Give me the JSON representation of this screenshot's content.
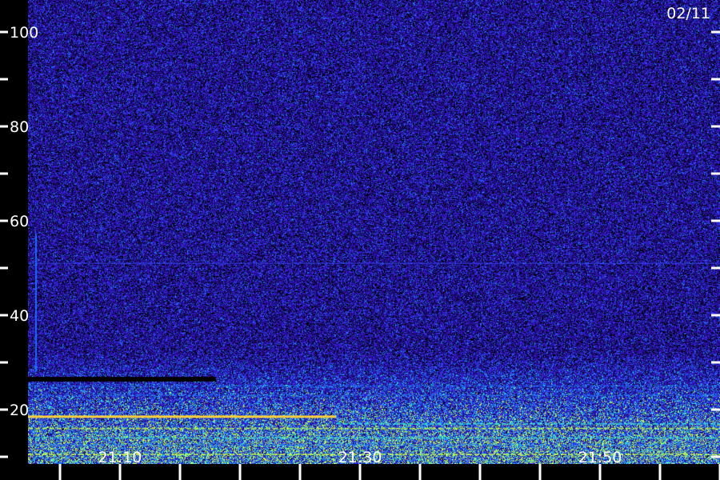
{
  "chart_data": {
    "type": "heatmap",
    "title": "",
    "date_label": "02/11",
    "xlabel": "",
    "ylabel": "",
    "x_ticks": [
      "21:10",
      "21:30",
      "21:50"
    ],
    "y_ticks": [
      20,
      40,
      60,
      80,
      100
    ],
    "ylim": [
      5,
      107
    ],
    "colormap": [
      "#000000",
      "#1a0a7a",
      "#3a1cd8",
      "#1e7bff",
      "#2fe0e0",
      "#c8ff40",
      "#ffd23a"
    ],
    "background_color": "#22117a",
    "bands": [
      {
        "name": "",
        "frequency": 18.5,
        "time_range": [
          "21:00",
          "21:28"
        ],
        "level": 0.95,
        "color": "#ffd23a"
      },
      {
        "name": "",
        "frequency": 17.0,
        "time_range": [
          "21:28",
          "22:00"
        ],
        "level": 0.7,
        "color": "#2fe0e0"
      },
      {
        "name": "",
        "frequency": 16.0,
        "time_range": [
          "21:00",
          "22:00"
        ],
        "level": 0.65,
        "color": "#c8ff40"
      },
      {
        "name": "",
        "frequency": 14.0,
        "time_range": [
          "21:00",
          "22:00"
        ],
        "level": 0.6,
        "color": "#2fe0e0"
      },
      {
        "name": "",
        "frequency": 12.5,
        "time_range": [
          "21:00",
          "22:00"
        ],
        "level": 0.55,
        "color": "#1e7bff"
      },
      {
        "name": "",
        "frequency": 10.5,
        "time_range": [
          "21:00",
          "22:00"
        ],
        "level": 0.65,
        "color": "#c8ff40"
      },
      {
        "name": "",
        "frequency": 25.0,
        "time_range": [
          "21:00",
          "22:00"
        ],
        "level": 0.5,
        "color": "#1e7bff"
      },
      {
        "name": "",
        "frequency": 23.0,
        "time_range": [
          "21:00",
          "22:00"
        ],
        "level": 0.45,
        "color": "#1e7bff"
      }
    ],
    "dark_band": {
      "frequency": 26.5,
      "time_range": [
        "21:00",
        "21:18"
      ]
    },
    "faint_lines": [
      {
        "frequency": 51.0,
        "time_range": [
          "21:00",
          "22:00"
        ]
      }
    ],
    "vertical_streak": {
      "time": "21:03",
      "freq_range": [
        28,
        57
      ]
    }
  }
}
